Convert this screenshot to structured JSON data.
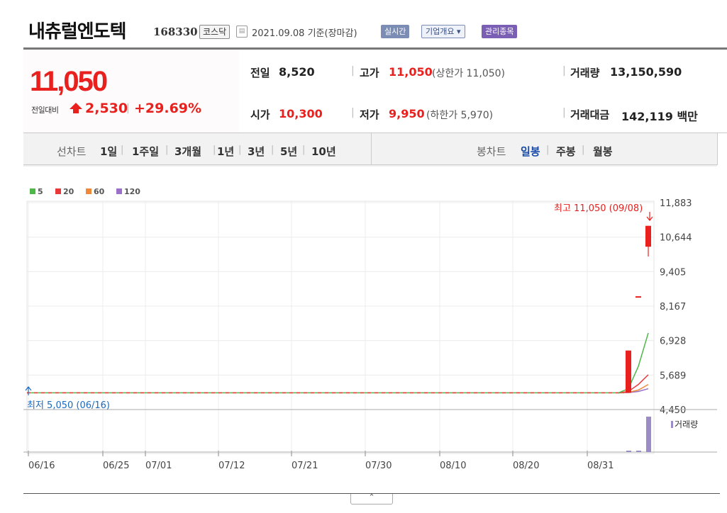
{
  "header": {
    "name": "내츄럴엔도텍",
    "code": "168330",
    "market": "코스닥",
    "date": "2021.09.08",
    "basis": "기준(장마감)",
    "realtime_label": "실시간",
    "company_label": "기업개요 ▾",
    "managed_label": "관리종목"
  },
  "quote": {
    "price": "11,050",
    "change_label": "전일대비",
    "change_value": "2,530",
    "change_pct": "+29.69%",
    "prev_label": "전일",
    "prev": "8,520",
    "high_label": "고가",
    "high": "11,050",
    "upper_limit": "(상한가 11,050)",
    "volume_label": "거래량",
    "volume": "13,150,590",
    "open_label": "시가",
    "open": "10,300",
    "low_label": "저가",
    "low": "9,950",
    "lower_limit": "(하한가 5,970)",
    "amount_label": "거래대금",
    "amount": "142,119",
    "amount_unit": "백만"
  },
  "tabs": {
    "line_label": "선차트",
    "line_items": [
      "1일",
      "1주일",
      "3개월",
      "1년",
      "3년",
      "5년",
      "10년"
    ],
    "candle_label": "봉차트",
    "candle_items": [
      "일봉",
      "주봉",
      "월봉"
    ],
    "selected_candle": "일봉"
  },
  "colors": {
    "up": "#e8201e",
    "down": "#1a6ac0",
    "ma5": "#4db848",
    "ma20": "#e8393a",
    "ma60": "#f0883a",
    "ma120": "#9b70c8",
    "volume": "#9b8cc8"
  },
  "chart_data": {
    "type": "candlestick",
    "legend": [
      {
        "name": "5",
        "color": "#4db848"
      },
      {
        "name": "20",
        "color": "#e8393a"
      },
      {
        "name": "60",
        "color": "#f0883a"
      },
      {
        "name": "120",
        "color": "#9b70c8"
      }
    ],
    "y_ticks": [
      "11,883",
      "10,644",
      "9,405",
      "8,167",
      "6,928",
      "5,689",
      "4,450"
    ],
    "ylim": [
      4450,
      11883
    ],
    "x_ticks": [
      "06/16",
      "06/25",
      "07/01",
      "07/12",
      "07/21",
      "07/30",
      "08/10",
      "08/20",
      "08/31"
    ],
    "high_annotation": "최고 11,050 (09/08)",
    "low_annotation": "최저 5,050 (06/16)",
    "flat_price": 5050,
    "candles": [
      {
        "date": "09/06",
        "open": 5050,
        "high": 6570,
        "low": 5050,
        "close": 6570
      },
      {
        "date": "09/07",
        "open": 8520,
        "high": 8520,
        "low": 8520,
        "close": 8520
      },
      {
        "date": "09/08",
        "open": 10300,
        "high": 11050,
        "low": 9950,
        "close": 11050
      }
    ],
    "ma5": [
      5050,
      5200,
      6000,
      7200
    ],
    "ma20": [
      5050,
      5100,
      5350,
      5700
    ],
    "ma60": [
      5050,
      5070,
      5150,
      5350
    ],
    "ma120": [
      5050,
      5060,
      5100,
      5200
    ],
    "volume_label": "거래량",
    "volume_relative": [
      0.03,
      0.03,
      1.0
    ]
  }
}
